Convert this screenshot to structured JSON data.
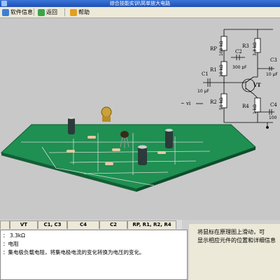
{
  "window": {
    "title": "综合技能实训\\简单放大电路"
  },
  "toolbar": {
    "items": [
      {
        "label": "软件信息"
      },
      {
        "label": "返回"
      },
      {
        "label": "帮助"
      }
    ]
  },
  "schematic": {
    "labels": {
      "rp": "RP",
      "r1": "R1",
      "r2": "R2",
      "r3": "R3",
      "r4": "R4",
      "c1": "C1",
      "c2": "C2",
      "c3": "C3",
      "c4": "C4",
      "vt": "VT",
      "vi": "~ vi",
      "rp_val": "100 kΩ",
      "r1_val": "10 kΩ",
      "r2_val": "51 kΩ",
      "r3_val": "3.3 kΩ",
      "r4_val": "1 kΩ",
      "c1_val": "10 μF",
      "c2_val": "300 pF",
      "c3_val": "10 μF",
      "c4_val": "100"
    }
  },
  "tabs": [
    {
      "label": ""
    },
    {
      "label": "VT"
    },
    {
      "label": "C1, C3"
    },
    {
      "label": "C4"
    },
    {
      "label": "C2"
    },
    {
      "label": "RP, R1, R2, R4"
    }
  ],
  "info_panel": {
    "lines": [
      "：  3.3kΩ",
      "：电阻",
      "：集电极负载电阻，将集电极电流的变化转换为电压的变化。"
    ]
  },
  "hint": {
    "lines": [
      "将鼠标在原理图上滑动，可",
      "显示相应元件的位置和详细信息"
    ]
  }
}
